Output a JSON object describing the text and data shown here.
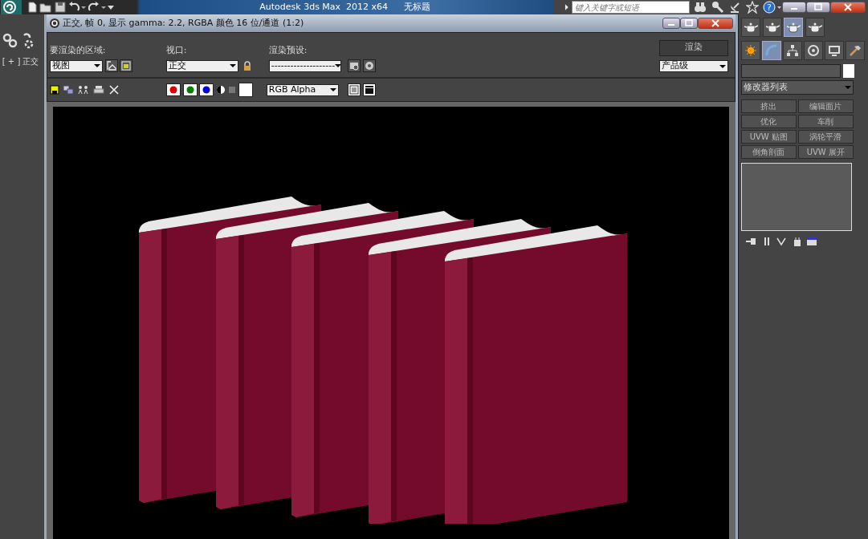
{
  "app": {
    "title": "Autodesk 3ds Max  2012 x64",
    "document": "无标题",
    "search_placeholder": "键入关键字或短语",
    "help_glyph": "?"
  },
  "viewport_label": "[ + ] 正交",
  "render_window": {
    "title": "正交, 帧 0, 显示 gamma: 2.2, RGBA 颜色 16 位/通道 (1:2)",
    "area_label": "要渲染的区域:",
    "area_value": "视图",
    "viewport_label": "视口:",
    "viewport_value": "正交",
    "preset_label": "渲染预设:",
    "preset_value": "--------------------",
    "render_button": "渲染",
    "quality_value": "产品级",
    "channel_display": "RGB Alpha",
    "channels": [
      {
        "color": "#e00000",
        "on": true
      },
      {
        "color": "#008000",
        "on": true
      },
      {
        "color": "#0000e0",
        "on": true
      }
    ]
  },
  "command_panel": {
    "render_tools": [
      {
        "selected": false
      },
      {
        "selected": false
      },
      {
        "selected": true
      },
      {
        "selected": false
      }
    ],
    "tabs": [
      {
        "selected": false
      },
      {
        "selected": true
      },
      {
        "selected": false
      },
      {
        "selected": false
      },
      {
        "selected": false
      },
      {
        "selected": false
      }
    ],
    "modifier_list": "修改器列表",
    "modifiers": [
      "挤出",
      "编辑面片",
      "优化",
      "车削",
      "UVW 贴图",
      "涡轮平滑",
      "倒角剖面",
      "UVW 展开"
    ]
  }
}
